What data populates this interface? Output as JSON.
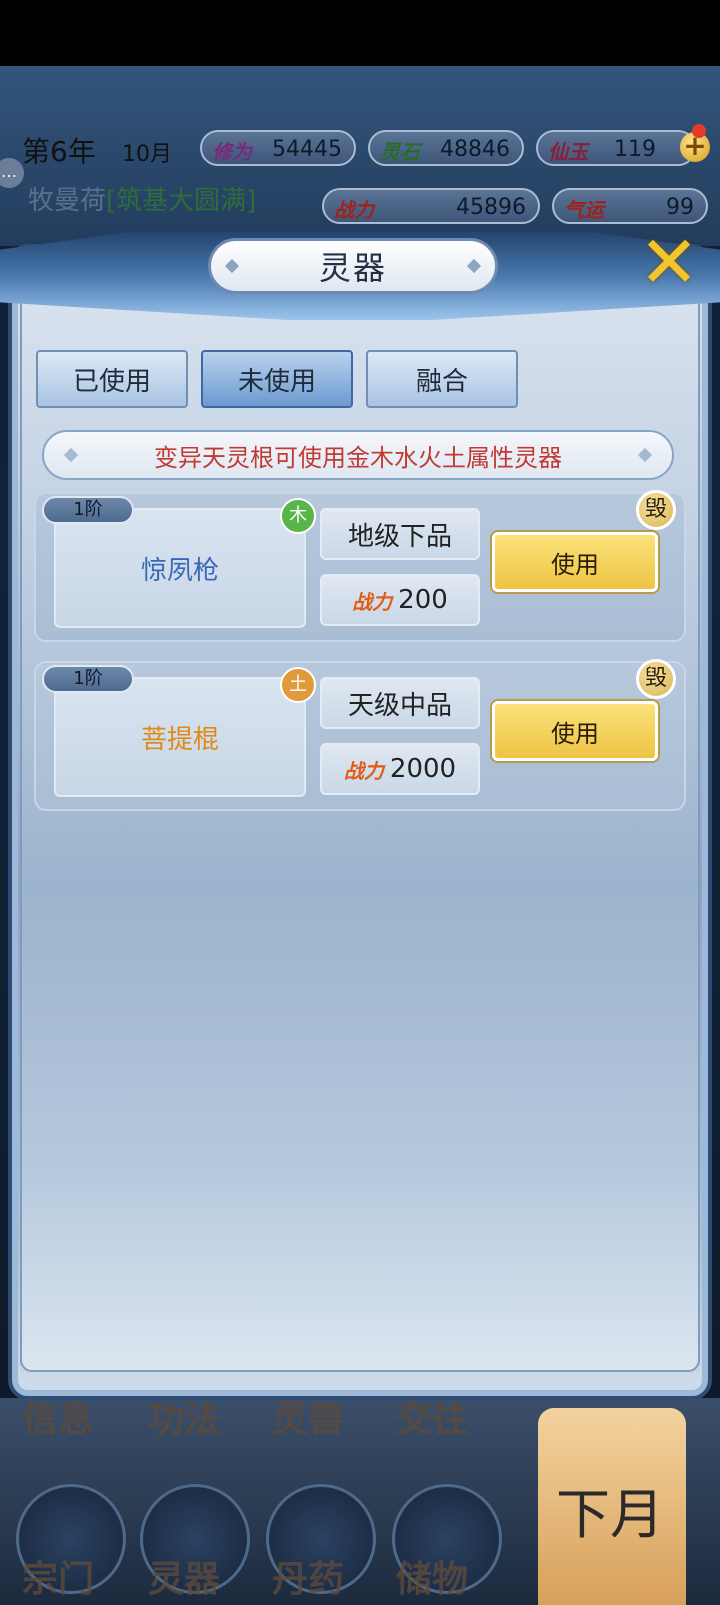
{
  "hud": {
    "year": "第6年",
    "month": "10月",
    "cultivation": {
      "label": "修为",
      "value": "54445"
    },
    "spirit_stone": {
      "label": "灵石",
      "value": "48846"
    },
    "immortal_jade": {
      "label": "仙玉",
      "value": "119"
    },
    "player_name": "牧曼荷",
    "player_rank": "[筑基大圆满]",
    "combat_power": {
      "label": "战力",
      "value": "45896"
    },
    "luck": {
      "label": "气运",
      "value": "99"
    }
  },
  "modal": {
    "title": "灵器",
    "tabs": [
      {
        "label": "已使用",
        "active": false
      },
      {
        "label": "未使用",
        "active": true
      },
      {
        "label": "融合",
        "active": false
      }
    ],
    "notice": "变异天灵根可使用金木水火土属性灵器",
    "items": [
      {
        "tier": "1阶",
        "name": "惊夙枪",
        "name_color": "#3a68b8",
        "element": "木",
        "element_color": "#58b54a",
        "grade": "地级下品",
        "power_label": "战力",
        "power": "200",
        "use_label": "使用",
        "destroy_label": "毁"
      },
      {
        "tier": "1阶",
        "name": "菩提棍",
        "name_color": "#e08a16",
        "element": "土",
        "element_color": "#e09a3c",
        "grade": "天级中品",
        "power_label": "战力",
        "power": "2000",
        "use_label": "使用",
        "destroy_label": "毁"
      }
    ]
  },
  "bottom_menu": {
    "row1": [
      "信息",
      "功法",
      "灵兽",
      "交往"
    ],
    "row2": [
      "宗门",
      "灵器",
      "丹药",
      "储物"
    ],
    "next_month": "下月"
  }
}
